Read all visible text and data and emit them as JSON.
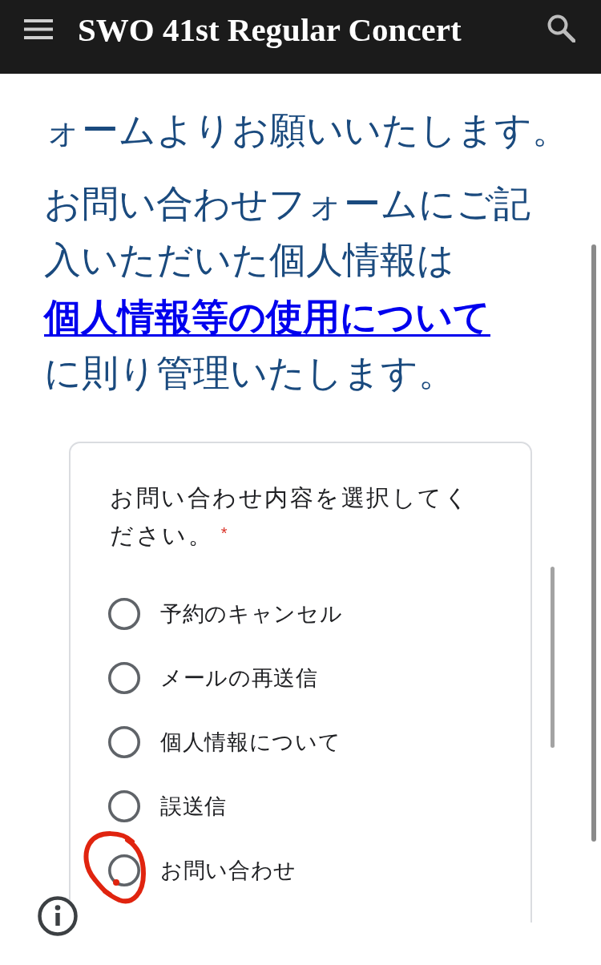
{
  "header": {
    "title": "SWO 41st Regular Concert"
  },
  "intro": {
    "text": "ォームよりお願いいたします。"
  },
  "notice": {
    "parts": [
      {
        "kind": "text",
        "text": "お問い合わせフォームにご記入いただいた個人情報は "
      },
      {
        "kind": "link",
        "text": "個人情報等の使用について"
      },
      {
        "kind": "text",
        "text": " に則り管理いたします。"
      }
    ]
  },
  "form": {
    "question": "お問い合わせ内容を選択してください。 $^{*}$",
    "options": [
      {
        "label": "予約のキャンセル",
        "selected": false
      },
      {
        "label": "メールの再送信",
        "selected": false
      },
      {
        "label": "個人情報について",
        "selected": false
      },
      {
        "label": "誤送信",
        "selected": false
      },
      {
        "label": "お問い合わせ",
        "selected": false
      }
    ]
  }
}
